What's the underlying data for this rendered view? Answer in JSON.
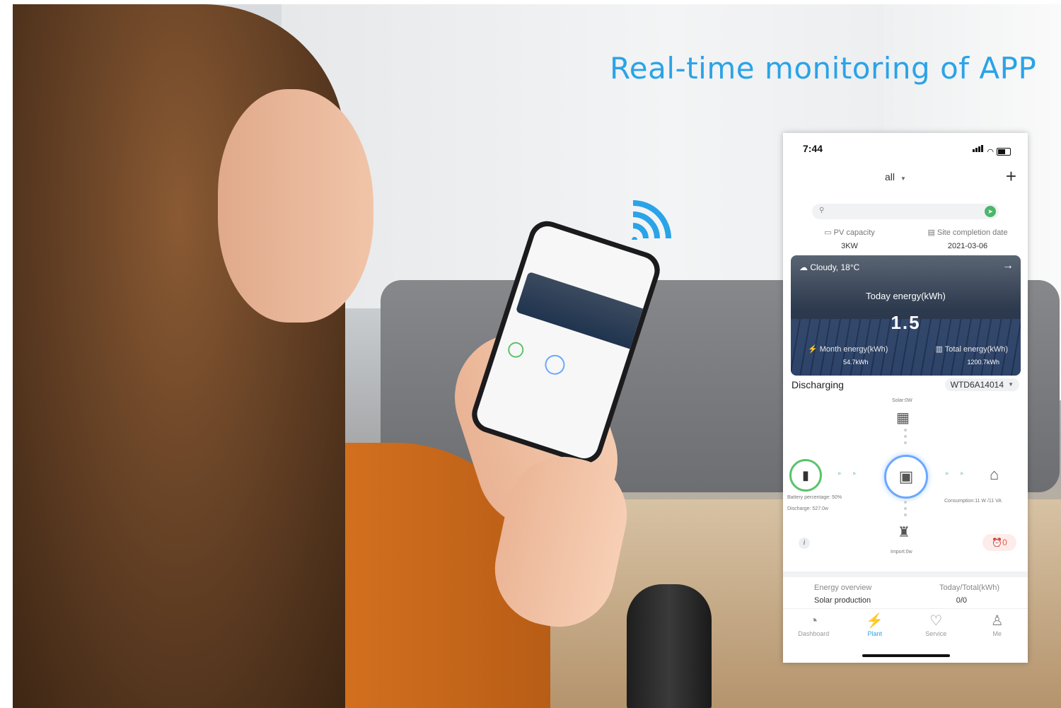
{
  "headline": "Real-time monitoring of APP",
  "colors": {
    "accent": "#2aa3e8",
    "green": "#3bb35a",
    "ring_blue": "#6aa8ff",
    "alarm": "#e85a3c"
  },
  "phone": {
    "status_time": "7:44",
    "site_selector": "all",
    "add_icon": "plus-icon",
    "search": {
      "placeholder": "",
      "location_icon": "pin-icon",
      "go_icon": "navigate-icon"
    },
    "pv_capacity": {
      "label": "PV capacity",
      "value": "3KW"
    },
    "site_completion": {
      "label": "Site completion date",
      "value": "2021-03-06"
    },
    "hero": {
      "weather": "Cloudy,  18°C",
      "today_label": "Today energy(kWh)",
      "today_value": "1.5",
      "month_label": "Month energy(kWh)",
      "month_value": "54.7kWh",
      "total_label": "Total energy(kWh)",
      "total_value": "1200.7kWh"
    },
    "flow": {
      "status": "Discharging",
      "device": "WTD6A14014",
      "solar_label": "Solar:0W",
      "battery_pct": "Battery percentage: 50%",
      "battery_discharge": "Discharge: 527.0w",
      "consumption": "Consumption:11 W /11 VA",
      "import": "Import:0w",
      "alarm_count": "0"
    },
    "energy": {
      "overview_label": "Energy overview",
      "solar_production": "Solar production",
      "today_total_label": "Today/Total(kWh)",
      "today_total_value": "0/0"
    },
    "nav": [
      {
        "label": "Dashboard",
        "icon": "dashboard-icon"
      },
      {
        "label": "Plant",
        "icon": "plant-icon",
        "active": true
      },
      {
        "label": "Service",
        "icon": "service-icon"
      },
      {
        "label": "Me",
        "icon": "user-icon"
      }
    ]
  }
}
